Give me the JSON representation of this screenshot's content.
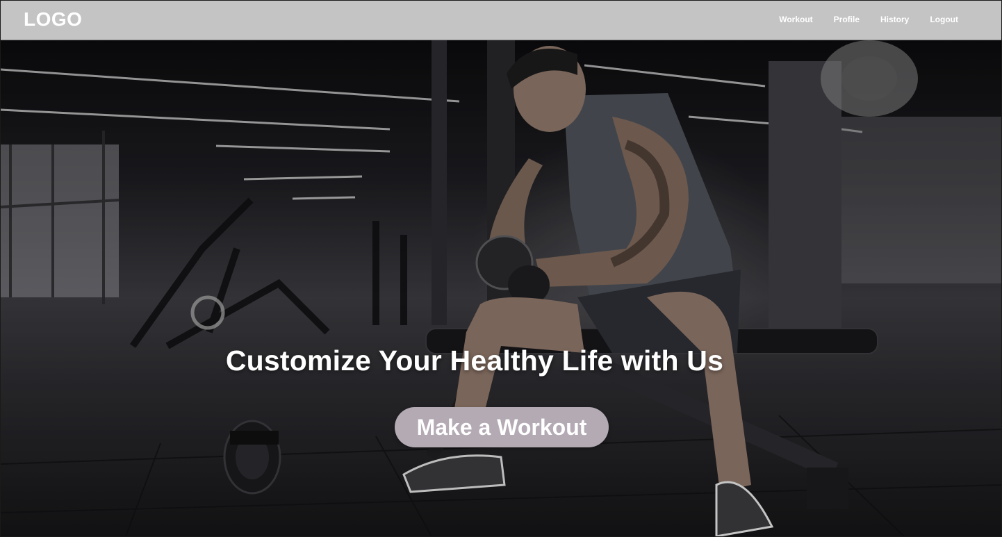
{
  "header": {
    "logo": "LOGO",
    "nav": [
      {
        "label": "Workout"
      },
      {
        "label": "Profile"
      },
      {
        "label": "History"
      },
      {
        "label": "Logout"
      }
    ]
  },
  "hero": {
    "title": "Customize Your Healthy Life with Us",
    "cta_label": "Make a Workout",
    "image": "gym-man-dumbbell-photo"
  },
  "colors": {
    "navbar_bg": "#c4c4c4",
    "cta_bg": "#b4aab4",
    "text": "#ffffff"
  }
}
